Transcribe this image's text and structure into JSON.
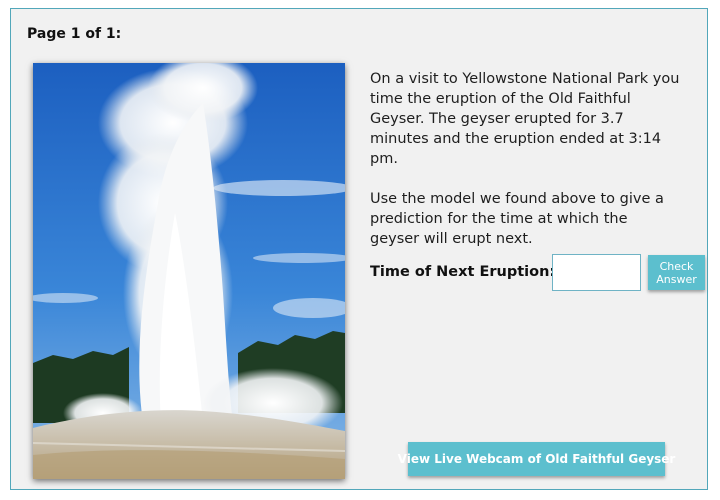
{
  "page": {
    "label": "Page 1 of 1:"
  },
  "problem": {
    "paragraph_1": "On a visit to Yellowstone National Park you time the eruption of the Old Faithful Geyser. The geyser erupted for 3.7 minutes and the eruption ended at 3:14 pm.",
    "paragraph_2": "Use the model we found above to give a prediction for the time at which the geyser will erupt next."
  },
  "answer": {
    "label": "Time of Next Eruption:",
    "value": "",
    "placeholder": "",
    "check_label": "Check Answer"
  },
  "webcam": {
    "label": "View Live Webcam of Old Faithful Geyser"
  },
  "colors": {
    "accent": "#5cbfce",
    "frame_border": "#52a7ba",
    "panel_background": "#f1f1f1"
  }
}
